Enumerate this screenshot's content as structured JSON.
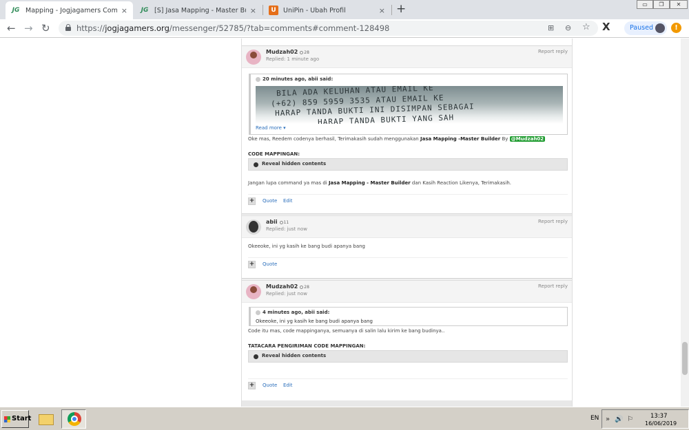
{
  "browser": {
    "tabs": [
      {
        "favicon": "JG",
        "title": "Mapping - Jogjagamers Community",
        "close": "×"
      },
      {
        "favicon": "JG",
        "title": "[S] Jasa Mapping - Master Builders",
        "close": "×"
      },
      {
        "favicon": "U",
        "title": "UniPin - Ubah Profil",
        "close": "×"
      }
    ],
    "new_tab": "+",
    "window_controls": [
      "▭",
      "❐",
      "✕"
    ],
    "nav": {
      "back": "←",
      "forward": "→",
      "reload": "↻"
    },
    "url": {
      "scheme": "https://",
      "host": "jogjagamers.org",
      "path": "/messenger/52785/?tab=comments#comment-128498"
    },
    "omnibox_icons": {
      "translate": "⊞",
      "zoom": "⊖",
      "star": "☆"
    },
    "extension_label": "X",
    "profile_status": "Paused",
    "menu_warning": "!"
  },
  "posts": [
    {
      "author": "Mudzah02",
      "rep": "28",
      "replied": "Replied: 1 minute ago",
      "report": "Report reply",
      "quote": {
        "header": "20 minutes ago, abii said:",
        "image_text": [
          "BILA ADA KELUHAN ATAU EMAIL KE",
          "(+62) 859 5959 3535 ATAU EMAIL KE",
          "HARAP TANDA BUKTI INI DISIMPAN SEBAGAI",
          "HARAP TANDA BUKTI YANG SAH"
        ],
        "read_more": "Read more ▾"
      },
      "message_pre": "Oke mas, Reedem codenya berhasil, Terimakasih sudah menggunakan",
      "message_bold": "Jasa Mapping -Master Builder",
      "message_by": "By",
      "mention": "@Mudzah02",
      "section_title": "CODE MAPPINGAN:",
      "spoiler": "Reveal hidden contents",
      "closing_pre": "Jangan lupa command ya mas di",
      "closing_bold": "Jasa Mapping - Master Builder",
      "closing_post": "dan Kasih Reaction Likenya, Terimakasih.",
      "actions": {
        "plus": "+",
        "quote": "Quote",
        "edit": "Edit"
      }
    },
    {
      "author": "abii",
      "rep": "11",
      "replied": "Replied: just now",
      "report": "Report reply",
      "message": "Okeeoke, ini yg kasih ke bang budi apanya bang",
      "actions": {
        "plus": "+",
        "quote": "Quote"
      }
    },
    {
      "author": "Mudzah02",
      "rep": "28",
      "replied": "Replied: just now",
      "report": "Report reply",
      "quote": {
        "header": "4 minutes ago, abii said:",
        "text": "Okeeoke, ini yg kasih ke bang budi apanya bang"
      },
      "message": "Code itu mas, code mappinganya, semuanya di salin lalu kirim ke bang budinya..",
      "section_title": "TATACARA PENGIRIMAN CODE MAPPINGAN:",
      "spoiler": "Reveal hidden contents",
      "actions": {
        "plus": "+",
        "quote": "Quote",
        "edit": "Edit"
      }
    }
  ],
  "taskbar": {
    "start": "Start",
    "language": "EN",
    "tray_icons": [
      "»",
      "🔊",
      "⚐"
    ],
    "time": "13:37",
    "date": "16/06/2019"
  }
}
